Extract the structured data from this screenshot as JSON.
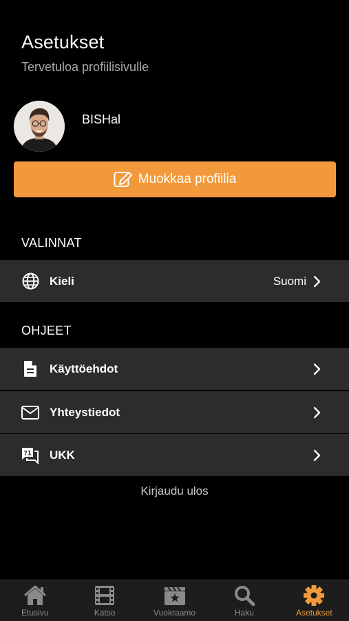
{
  "header": {
    "title": "Asetukset",
    "subtitle": "Tervetuloa profiilisivulle"
  },
  "profile": {
    "username": "BISHal",
    "edit_label": "Muokkaa profiilia"
  },
  "sections": {
    "choices_title": "VALINNAT",
    "help_title": "OHJEET"
  },
  "rows": {
    "language": {
      "label": "Kieli",
      "value": "Suomi",
      "icon": "globe-icon"
    },
    "terms": {
      "label": "Käyttöehdot",
      "icon": "document-icon"
    },
    "contact": {
      "label": "Yhteystiedot",
      "icon": "mail-icon"
    },
    "faq": {
      "label": "UKK",
      "icon": "faq-icon"
    }
  },
  "logout_label": "Kirjaudu ulos",
  "tabbar": {
    "tabs": [
      {
        "label": "Etusivu",
        "icon": "home-icon"
      },
      {
        "label": "Katso",
        "icon": "film-icon"
      },
      {
        "label": "Vuokraamo",
        "icon": "clapper-icon"
      },
      {
        "label": "Haku",
        "icon": "search-icon"
      },
      {
        "label": "Asetukset",
        "icon": "gear-icon",
        "active": true
      }
    ]
  },
  "colors": {
    "accent": "#f29a3b",
    "row_bg": "#2c2c2c",
    "background": "#000000"
  }
}
